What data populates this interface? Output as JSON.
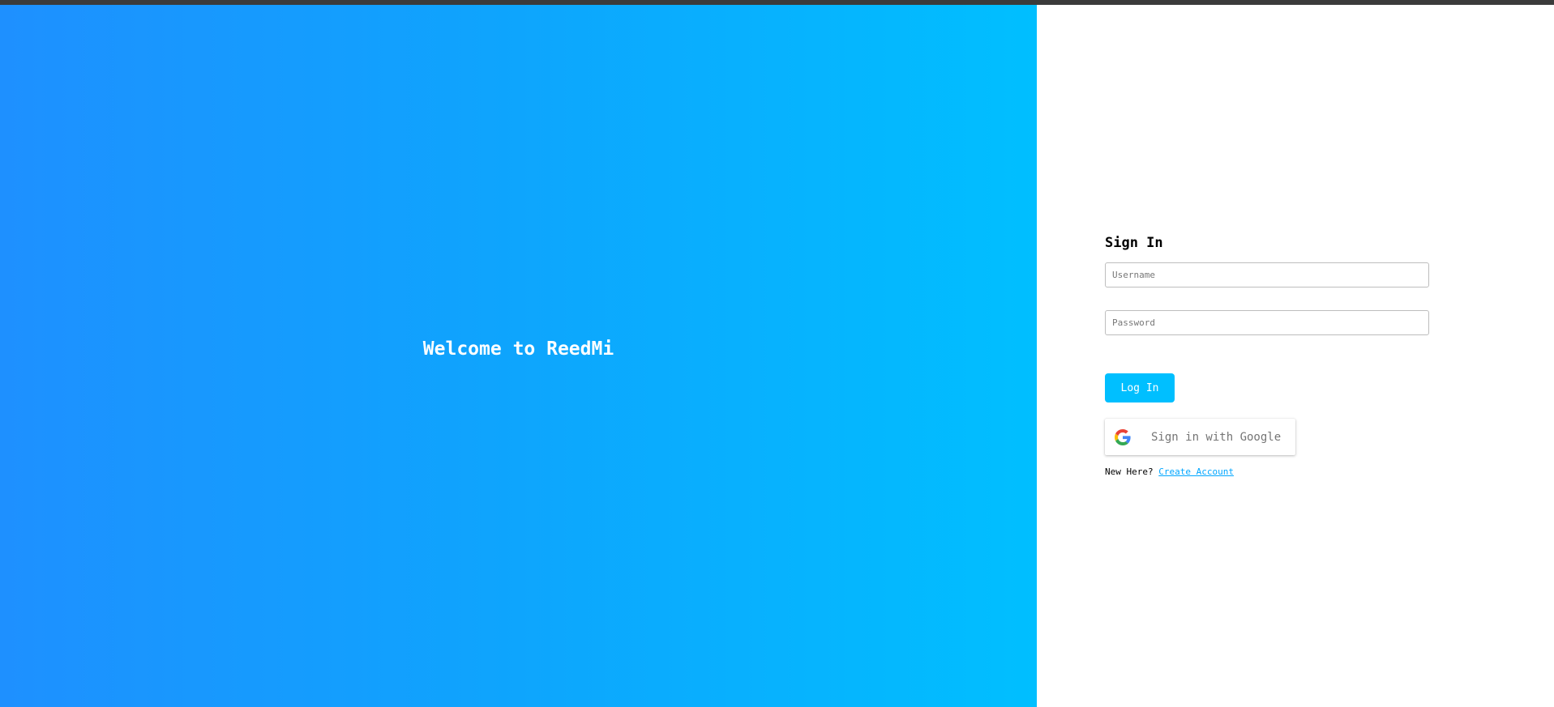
{
  "hero": {
    "title": "Welcome to ReedMi"
  },
  "form": {
    "title": "Sign In",
    "username_placeholder": "Username",
    "password_placeholder": "Password",
    "login_label": "Log In",
    "google_label": "Sign in with Google",
    "signup_prompt": "New Here?",
    "signup_link": "Create Account"
  },
  "colors": {
    "hero_start": "#1e90ff",
    "hero_end": "#00bfff",
    "accent": "#00bfff",
    "link": "#00a6ff"
  },
  "icons": {
    "google": "google-g-icon"
  }
}
